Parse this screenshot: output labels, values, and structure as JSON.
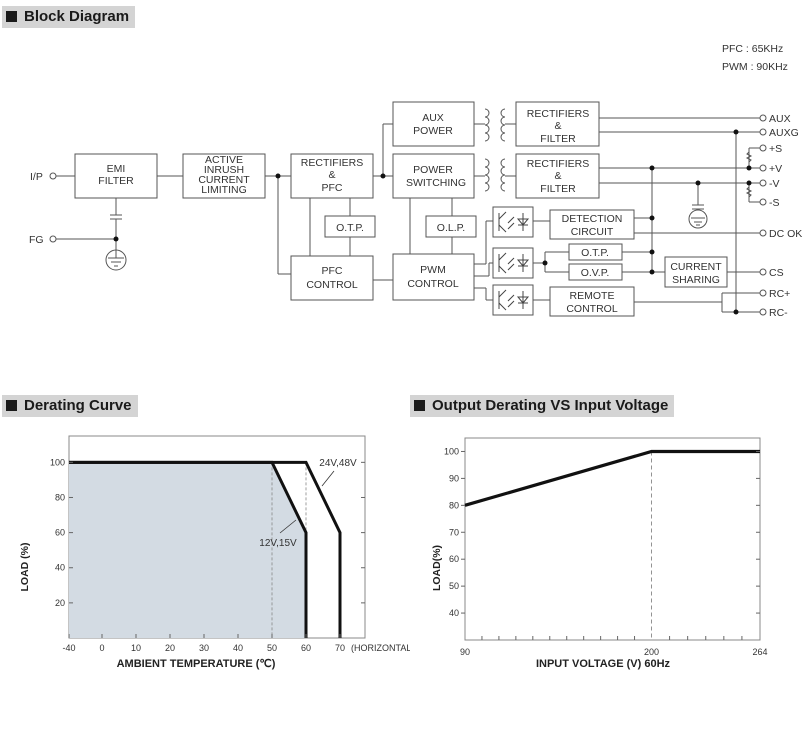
{
  "sections": {
    "block_diagram": "Block Diagram",
    "derating_curve": "Derating Curve",
    "output_derating": "Output Derating VS Input Voltage"
  },
  "block_diagram": {
    "notes": [
      "PFC : 65KHz",
      "PWM : 90KHz"
    ],
    "blocks": {
      "emi_filter": [
        "EMI",
        "FILTER"
      ],
      "inrush": [
        "ACTIVE",
        "INRUSH",
        "CURRENT",
        "LIMITING"
      ],
      "rect_pfc": [
        "RECTIFIERS",
        "&",
        "PFC"
      ],
      "otp1": [
        "O.T.P."
      ],
      "pfc_control": [
        "PFC",
        "CONTROL"
      ],
      "aux_power": [
        "AUX",
        "POWER"
      ],
      "power_switching": [
        "POWER",
        "SWITCHING"
      ],
      "olp": [
        "O.L.P."
      ],
      "pwm_control": [
        "PWM",
        "CONTROL"
      ],
      "rect_filter1": [
        "RECTIFIERS",
        "&",
        "FILTER"
      ],
      "rect_filter2": [
        "RECTIFIERS",
        "&",
        "FILTER"
      ],
      "detection": [
        "DETECTION",
        "CIRCUIT"
      ],
      "otp2": [
        "O.T.P."
      ],
      "ovp": [
        "O.V.P."
      ],
      "remote": [
        "REMOTE",
        "CONTROL"
      ],
      "current_sharing": [
        "CURRENT",
        "SHARING"
      ]
    },
    "pins": {
      "ip": "I/P",
      "fg": "FG",
      "aux": "AUX",
      "auxg": "AUXG",
      "plus_s": "+S",
      "plus_v": "+V",
      "minus_v": "-V",
      "minus_s": "-S",
      "dc_ok": "DC OK",
      "cs": "CS",
      "rc_plus": "RC+",
      "rc_minus": "RC-"
    }
  },
  "chart_data": [
    {
      "type": "line",
      "title": "Derating Curve",
      "xlabel": "AMBIENT TEMPERATURE (℃)",
      "ylabel": "LOAD (%)",
      "xlim": [
        -40,
        80
      ],
      "ylim": [
        0,
        115
      ],
      "x_ticks": [
        -40,
        0,
        10,
        20,
        30,
        40,
        50,
        60,
        70
      ],
      "x_tick_labels": [
        "-40",
        "0",
        "10",
        "20",
        "30",
        "40",
        "50",
        "60",
        "70"
      ],
      "y_ticks": [
        20,
        40,
        60,
        80,
        100
      ],
      "y_tick_labels": [
        "20",
        "40",
        "60",
        "80",
        "100"
      ],
      "x_note": "(HORIZONTAL)",
      "fill_color": "#d3dbe3",
      "series": [
        {
          "name": "12V,15V",
          "x": [
            -40,
            50,
            60,
            60
          ],
          "y": [
            100,
            100,
            60,
            0
          ],
          "filled": true
        },
        {
          "name": "24V,48V",
          "x": [
            -40,
            60,
            70,
            70
          ],
          "y": [
            100,
            100,
            60,
            0
          ],
          "filled": false
        }
      ],
      "guides_x": [
        50,
        60
      ],
      "annotations": [
        "12V,15V",
        "24V,48V"
      ]
    },
    {
      "type": "line",
      "title": "Output Derating VS Input Voltage",
      "xlabel": "INPUT VOLTAGE (V) 60Hz",
      "ylabel": "LOAD(%)",
      "xlim": [
        90,
        264
      ],
      "ylim": [
        30,
        105
      ],
      "x_tick_labels": [
        "90",
        "200",
        "264"
      ],
      "x_labeled_ticks": [
        90,
        200,
        264
      ],
      "minor_x_step": 10,
      "y_ticks": [
        40,
        50,
        60,
        70,
        80,
        90,
        100
      ],
      "y_tick_labels": [
        "40",
        "50",
        "60",
        "70",
        "80",
        "90",
        "100"
      ],
      "series": [
        {
          "name": "load",
          "x": [
            90,
            200,
            264
          ],
          "y": [
            80,
            100,
            100
          ]
        }
      ],
      "guides_x": [
        200
      ]
    }
  ]
}
